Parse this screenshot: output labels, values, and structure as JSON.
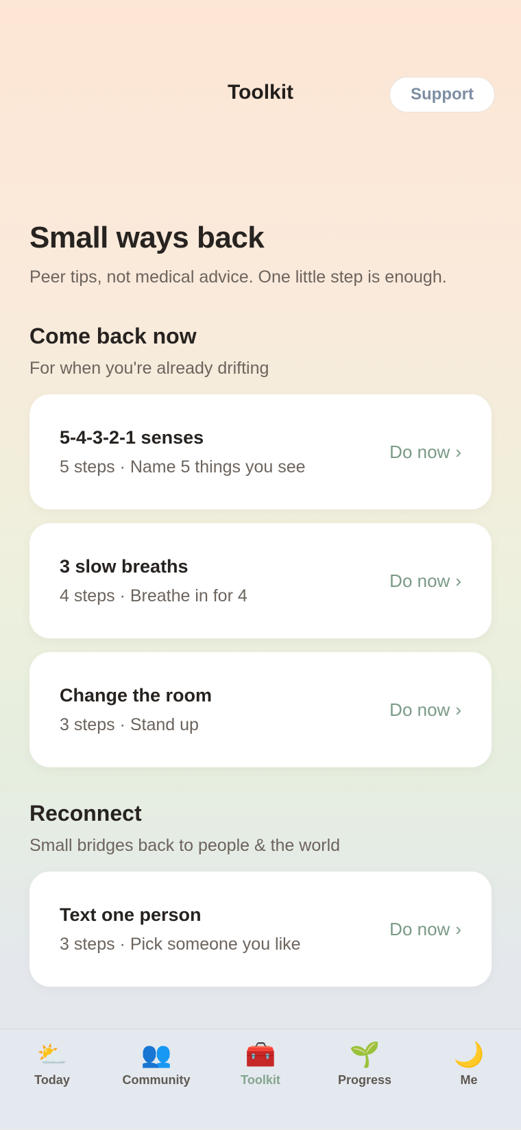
{
  "header": {
    "title": "Toolkit",
    "support_label": "Support"
  },
  "hero": {
    "title": "Small ways back",
    "subtitle": "Peer tips, not medical advice. One little step is enough."
  },
  "sections": [
    {
      "title": "Come back now",
      "subtitle": "For when you're already drifting",
      "cards": [
        {
          "title": "5-4-3-2-1 senses",
          "meta": "5 steps · Name 5 things you see",
          "action": "Do now",
          "chevron": "›"
        },
        {
          "title": "3 slow breaths",
          "meta": "4 steps · Breathe in for 4",
          "action": "Do now",
          "chevron": "›"
        },
        {
          "title": "Change the room",
          "meta": "3 steps · Stand up",
          "action": "Do now",
          "chevron": "›"
        }
      ]
    },
    {
      "title": "Reconnect",
      "subtitle": "Small bridges back to people & the world",
      "cards": [
        {
          "title": "Text one person",
          "meta": "3 steps · Pick someone you like",
          "action": "Do now",
          "chevron": "›"
        }
      ]
    }
  ],
  "tabbar": {
    "tabs": [
      {
        "label": "Today",
        "icon": "sun-behind-cloud-icon",
        "glyph": "⛅"
      },
      {
        "label": "Community",
        "icon": "people-icon",
        "glyph": "👥"
      },
      {
        "label": "Toolkit",
        "icon": "toolbox-icon",
        "glyph": "🧰",
        "active": true
      },
      {
        "label": "Progress",
        "icon": "seedling-icon",
        "glyph": "🌱"
      },
      {
        "label": "Me",
        "icon": "crescent-moon-icon",
        "glyph": "🌙"
      }
    ]
  },
  "colors": {
    "accent": "#84a58f",
    "action": "#7a9a86",
    "support_text": "#7d8ea3"
  }
}
